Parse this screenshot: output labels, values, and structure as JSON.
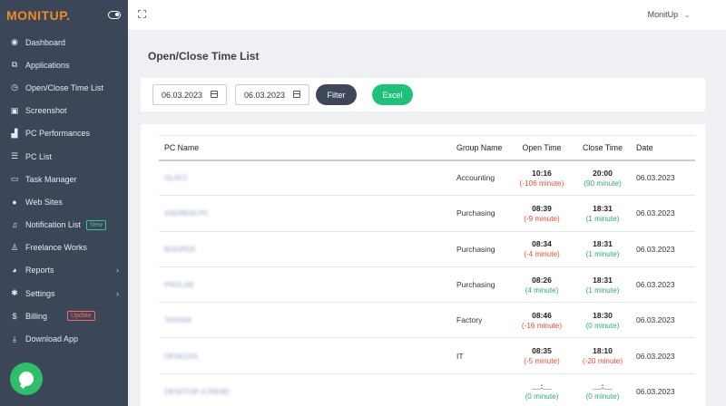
{
  "brand": {
    "logo": "MONITUP."
  },
  "sidebar": {
    "items": [
      {
        "label": "Dashboard",
        "icon": "dashboard-icon",
        "glyph": "◉"
      },
      {
        "label": "Applications",
        "icon": "applications-icon",
        "glyph": "⧉"
      },
      {
        "label": "Open/Close Time List",
        "icon": "clock-icon",
        "glyph": "◷"
      },
      {
        "label": "Screenshot",
        "icon": "camera-icon",
        "glyph": "▣"
      },
      {
        "label": "PC Performances",
        "icon": "area-chart-icon",
        "glyph": "▟"
      },
      {
        "label": "PC List",
        "icon": "list-icon",
        "glyph": "☰"
      },
      {
        "label": "Task Manager",
        "icon": "monitor-icon",
        "glyph": "▭"
      },
      {
        "label": "Web Sites",
        "icon": "globe-icon",
        "glyph": "●"
      },
      {
        "label": "Notification List",
        "icon": "bell-icon",
        "glyph": "♫",
        "tag": "New"
      },
      {
        "label": "Freelance Works",
        "icon": "user-icon",
        "glyph": "♙"
      },
      {
        "label": "Reports",
        "icon": "pie-chart-icon",
        "glyph": "◕",
        "chevron": "›"
      },
      {
        "label": "Settings",
        "icon": "gear-icon",
        "glyph": "✱",
        "chevron": "›"
      },
      {
        "label": "Billing",
        "icon": "dollar-icon",
        "glyph": "$",
        "tag": "Update"
      },
      {
        "label": "Download App",
        "icon": "download-icon",
        "glyph": "⤓"
      }
    ]
  },
  "topbar": {
    "user": "MonitUp",
    "caret": "⌄"
  },
  "page": {
    "title": "Open/Close Time List"
  },
  "filters": {
    "start_date": "06.03.2023",
    "end_date": "06.03.2023",
    "filter_label": "Filter",
    "excel_label": "Excel"
  },
  "table": {
    "headers": {
      "pc": "PC Name",
      "group": "Group Name",
      "open": "Open Time",
      "close": "Close Time",
      "date": "Date"
    },
    "rows": [
      {
        "pc": "OLAF2",
        "group": "Accounting",
        "open": "10:16",
        "open_diff": "(-106 minute)",
        "open_neg": true,
        "close": "20:00",
        "close_diff": "(90 minute)",
        "close_neg": false,
        "date": "06.03.2023"
      },
      {
        "pc": "ANDREW-PC",
        "group": "Purchasing",
        "open": "08:39",
        "open_diff": "(-9 minute)",
        "open_neg": true,
        "close": "18:31",
        "close_diff": "(1 minute)",
        "close_neg": false,
        "date": "06.03.2023"
      },
      {
        "pc": "BOOPER",
        "group": "Purchasing",
        "open": "08:34",
        "open_diff": "(-4 minute)",
        "open_neg": true,
        "close": "18:31",
        "close_diff": "(1 minute)",
        "close_neg": false,
        "date": "06.03.2023"
      },
      {
        "pc": "PROLAB",
        "group": "Purchasing",
        "open": "08:26",
        "open_diff": "(4 minute)",
        "open_neg": false,
        "close": "18:31",
        "close_diff": "(1 minute)",
        "close_neg": false,
        "date": "06.03.2023"
      },
      {
        "pc": "TAYANA",
        "group": "Factory",
        "open": "08:46",
        "open_diff": "(-16 minute)",
        "open_neg": true,
        "close": "18:30",
        "close_diff": "(0 minute)",
        "close_neg": false,
        "date": "06.03.2023"
      },
      {
        "pc": "DESKOOL",
        "group": "IT",
        "open": "08:35",
        "open_diff": "(-5 minute)",
        "open_neg": true,
        "close": "18:10",
        "close_diff": "(-20 minute)",
        "close_neg": true,
        "date": "06.03.2023"
      },
      {
        "pc": "DESKTOP-A7RE8D",
        "group": "",
        "open": "__:__",
        "open_diff": "(0 minute)",
        "open_neg": false,
        "close": "__:__",
        "close_diff": "(0 minute)",
        "close_neg": false,
        "date": "06.03.2023"
      }
    ]
  },
  "colors": {
    "sidebar": "#3c4659",
    "brand": "#f08a24",
    "excel": "#1fc07a",
    "filter": "#3d4759",
    "negative": "#e24a3b",
    "positive": "#2fab6c"
  }
}
